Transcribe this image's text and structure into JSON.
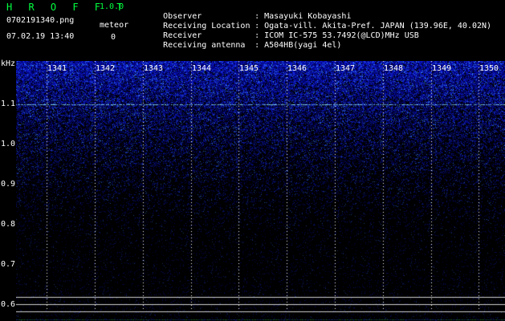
{
  "header": {
    "app_title": "H R O F F T",
    "version": "1.0.0",
    "filename": "0702191340.png",
    "datetime": "07.02.19 13:40",
    "meteor_label": "meteor",
    "meteor_count": "0",
    "info": [
      {
        "key": "Observer",
        "sep": ":",
        "value": "Masayuki Kobayashi"
      },
      {
        "key": "Receiving Location",
        "sep": ":",
        "value": "Ogata-vill. Akita-Pref. JAPAN (139.96E, 40.02N)"
      },
      {
        "key": "Receiver",
        "sep": ":",
        "value": "ICOM IC-575 53.7492(@LCD)MHz USB"
      },
      {
        "key": "Receiving antenna",
        "sep": ":",
        "value": "A504HB(yagi 4el)"
      }
    ]
  },
  "axis": {
    "unit_label": "kHz",
    "freq_labels": [
      "1.1",
      "1.0",
      "0.9",
      "0.8",
      "0.7",
      "0.6"
    ],
    "time_labels": [
      "1341",
      "1342",
      "1343",
      "1344",
      "1345",
      "1346",
      "1347",
      "1348",
      "1349",
      "1350"
    ]
  },
  "colors": {
    "title_green": "#00ff40",
    "signal_blue": "#1a3cff",
    "carrier_cyan": "#8fe8ff",
    "grid_white": "#ffffff"
  }
}
